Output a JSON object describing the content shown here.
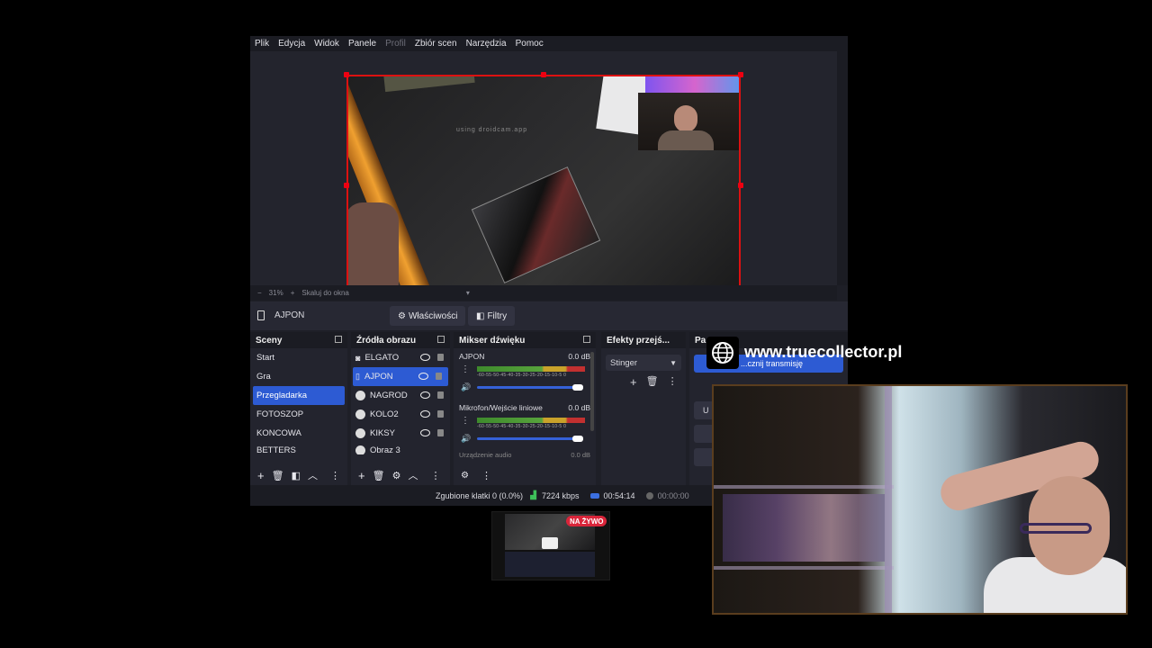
{
  "menu": [
    "Plik",
    "Edycja",
    "Widok",
    "Panele",
    "Profil",
    "Zbiór scen",
    "Narzędzia",
    "Pomoc"
  ],
  "preview": {
    "watermark": "using droidcam.app",
    "zoom": "31%",
    "scale_mode": "Skaluj do okna"
  },
  "properties_bar": {
    "source_name": "AJPON",
    "properties_label": "Właściwości",
    "filters_label": "Filtry"
  },
  "scenes": {
    "title": "Sceny",
    "items": [
      "Start",
      "Gra",
      "Przegladarka",
      "FOTOSZOP",
      "KONCOWA",
      "BETTERS"
    ],
    "selected": "Przegladarka"
  },
  "sources": {
    "title": "Źródła obrazu",
    "items": [
      "ELGATO",
      "AJPON",
      "NAGROD",
      "KOLO2",
      "KIKSY",
      "Obraz 3"
    ],
    "selected": "AJPON"
  },
  "mixer": {
    "title": "Mikser dźwięku",
    "channels": [
      {
        "name": "AJPON",
        "level": "0.0 dB"
      },
      {
        "name": "Mikrofon/Wejście liniowe",
        "level": "0.0 dB"
      },
      {
        "name": "Urządzenie audio",
        "level": "0.0 dB"
      }
    ],
    "ticks": "-60-55-50-45-40-35-30-25-20-15-10-5 0"
  },
  "transitions": {
    "title": "Efekty przejś...",
    "selected": "Stinger"
  },
  "controls": {
    "title": "Pa",
    "stream_button": "...cznij transmisję",
    "btn2": "U"
  },
  "status": {
    "dropped": "Zgubione klatki 0 (0.0%)",
    "bitrate": "7224 kbps",
    "stream_time": "00:54:14",
    "rec_time": "00:00:00"
  },
  "overlay": {
    "website": "www.truecollector.pl",
    "live_badge": "NA ŻYWO"
  },
  "colors": {
    "accent": "#2d5bd3",
    "selection_border": "#dd1111",
    "live": "#d9253a"
  }
}
